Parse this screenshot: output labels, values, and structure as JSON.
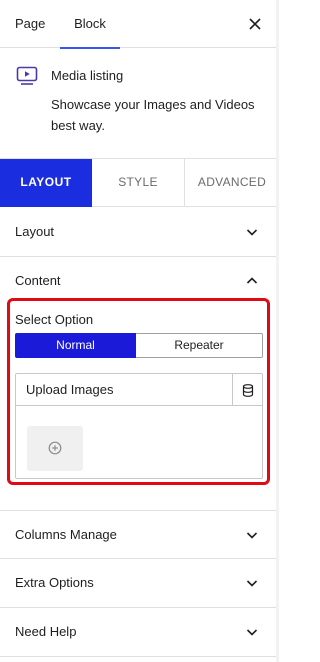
{
  "header": {
    "tabs": [
      {
        "label": "Page"
      },
      {
        "label": "Block"
      }
    ],
    "close_icon": "close-icon"
  },
  "block_card": {
    "icon": "media-play-icon",
    "title": "Media listing",
    "description": "Showcase your Images and Videos best way."
  },
  "inspector_tabs": [
    {
      "label": "LAYOUT",
      "active": true
    },
    {
      "label": "STYLE",
      "active": false
    },
    {
      "label": "ADVANCED",
      "active": false
    }
  ],
  "panels": {
    "layout": {
      "label": "Layout",
      "expanded": false
    },
    "content": {
      "label": "Content",
      "expanded": true,
      "select_option": {
        "label": "Select Option",
        "options": [
          "Normal",
          "Repeater"
        ],
        "selected": "Normal"
      },
      "upload": {
        "title": "Upload Images",
        "database_icon": "database-icon",
        "add_icon": "plus-circle-icon"
      }
    },
    "columns_manage": {
      "label": "Columns Manage",
      "expanded": false
    },
    "extra_options": {
      "label": "Extra Options",
      "expanded": false
    },
    "need_help": {
      "label": "Need Help",
      "expanded": false
    }
  },
  "colors": {
    "accent": "#1a2ee0",
    "active_tab_underline": "#3858e9",
    "highlight_border": "#e00a14"
  }
}
